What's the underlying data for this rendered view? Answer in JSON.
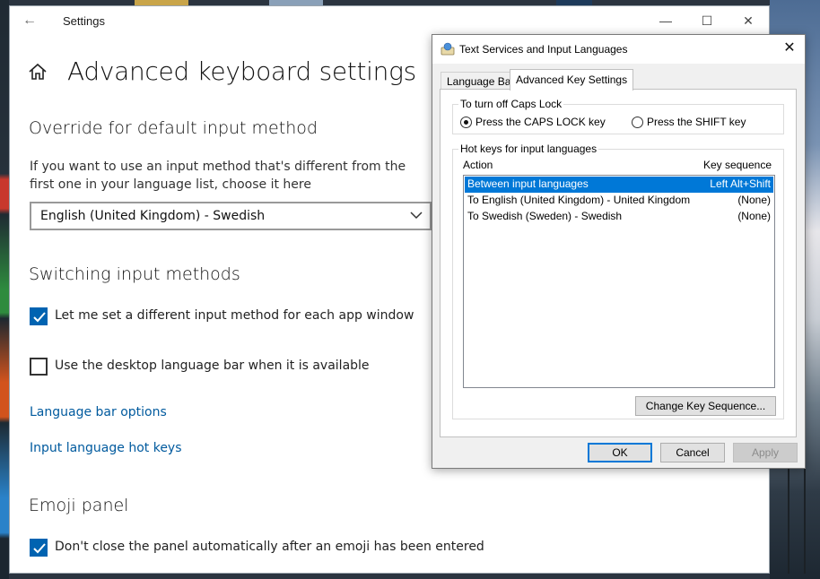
{
  "settings_window": {
    "title": "Settings",
    "page_title": "Advanced keyboard settings",
    "override": {
      "heading": "Override for default input method",
      "description": "If you want to use an input method that's different from the first one in your language list, choose it here",
      "selected_value": "English (United Kingdom) - Swedish"
    },
    "switching": {
      "heading": "Switching input methods",
      "checkbox1_label": "Let me set a different input method for each app window",
      "checkbox1_checked": true,
      "checkbox2_label": "Use the desktop language bar when it is available",
      "checkbox2_checked": false,
      "link1": "Language bar options",
      "link2": "Input language hot keys"
    },
    "emoji": {
      "heading": "Emoji panel",
      "checkbox_label": "Don't close the panel automatically after an emoji has been entered",
      "checkbox_checked": true
    }
  },
  "dialog": {
    "title": "Text Services and Input Languages",
    "tabs": [
      {
        "label": "Language Bar",
        "active": false
      },
      {
        "label": "Advanced Key Settings",
        "active": true
      }
    ],
    "caps_lock": {
      "group_label": "To turn off Caps Lock",
      "option1": "Press the CAPS LOCK key",
      "option1_selected": true,
      "option2": "Press the SHIFT key",
      "option2_selected": false
    },
    "hotkeys": {
      "group_label": "Hot keys for input languages",
      "col_action": "Action",
      "col_key": "Key sequence",
      "rows": [
        {
          "action": "Between input languages",
          "key": "Left Alt+Shift",
          "selected": true
        },
        {
          "action": "To English (United Kingdom) - United Kingdom",
          "key": "(None)",
          "selected": false
        },
        {
          "action": "To Swedish (Sweden) - Swedish",
          "key": "(None)",
          "selected": false
        }
      ],
      "change_button": "Change Key Sequence..."
    },
    "buttons": {
      "ok": "OK",
      "cancel": "Cancel",
      "apply": "Apply"
    }
  },
  "colors": {
    "accent": "#0063b1",
    "link": "#005a9e",
    "selection": "#0078d7"
  }
}
